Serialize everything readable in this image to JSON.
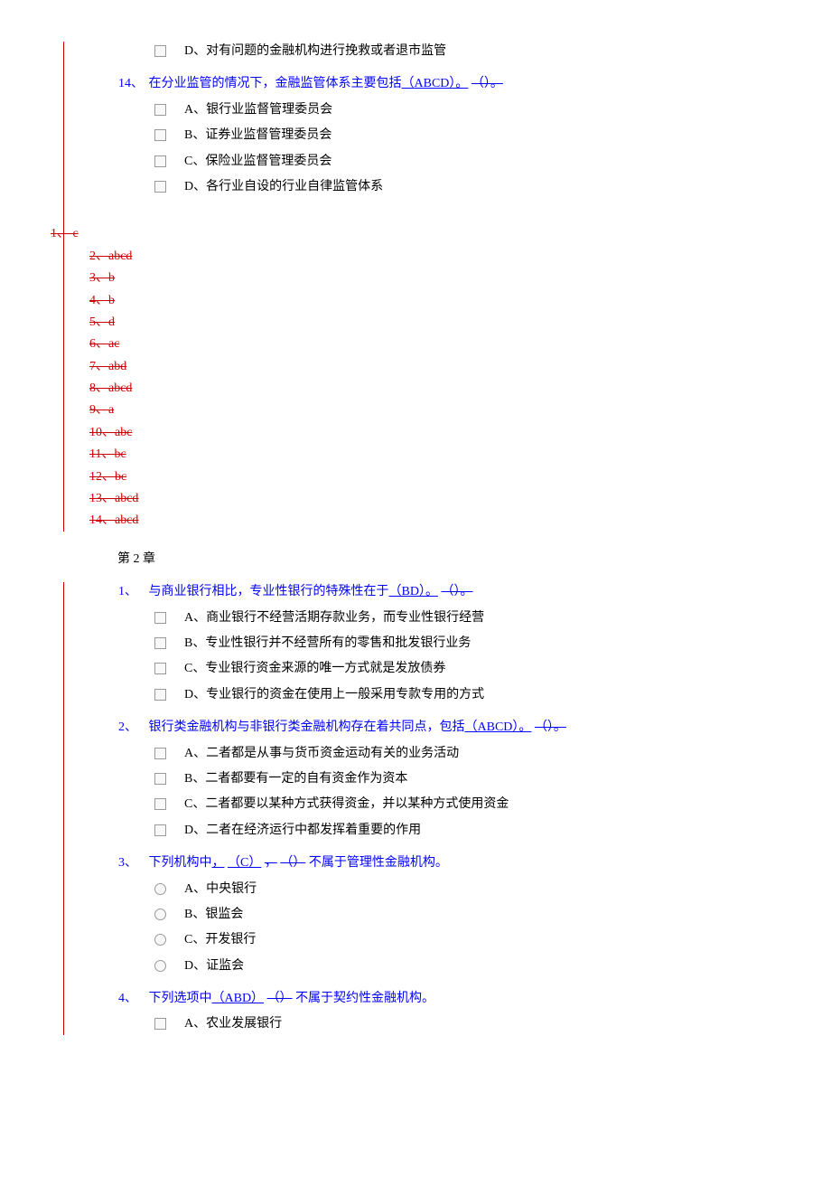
{
  "q13": {
    "optD": "D、对有问题的金融机构进行挽救或者退市监管"
  },
  "q14": {
    "num": "14、",
    "text_pre": "在分业监管的情况下，金融监管体系主要包括",
    "ins": "（ABCD）。",
    "del": "（）。",
    "optA": "A、银行业监督管理委员会",
    "optB": "B、证券业监督管理委员会",
    "optC": "C、保险业监督管理委员会",
    "optD": "D、各行业自设的行业自律监管体系"
  },
  "answers": {
    "a1": "1、    c",
    "a2": "2、abcd",
    "a3": "3、b",
    "a4": "4、b",
    "a5": "5、d",
    "a6": "6、ac",
    "a7": "7、abd",
    "a8": "8、abcd",
    "a9": "9、a",
    "a10": "10、abc",
    "a11": "11、bc",
    "a12": "12、bc",
    "a13": "13、abcd",
    "a14": "14、abcd"
  },
  "chapter2": "第 2 章",
  "c2q1": {
    "num": "1、",
    "text_pre": "与商业银行相比，专业性银行的特殊性在于",
    "ins": "（BD）。",
    "del": "（）。",
    "optA": "A、商业银行不经营活期存款业务，而专业性银行经营",
    "optB": "B、专业性银行并不经营所有的零售和批发银行业务",
    "optC": "C、专业银行资金来源的唯一方式就是发放债券",
    "optD": "D、专业银行的资金在使用上一般采用专款专用的方式"
  },
  "c2q2": {
    "num": "2、",
    "text_pre": "银行类金融机构与非银行类金融机构存在着共同点，包括",
    "ins": "（ABCD）。",
    "del": "（）。",
    "optA": "A、二者都是从事与货币资金运动有关的业务活动",
    "optB": "B、二者都要有一定的自有资金作为资本",
    "optC": "C、二者都要以某种方式获得资金，并以某种方式使用资金",
    "optD": "D、二者在经济运行中都发挥着重要的作用"
  },
  "c2q3": {
    "num": "3、",
    "text_pre": "下列机构中",
    "ins_comma": "，",
    "ins": "（C）",
    "del_comma": "，",
    "del": "（）",
    "text_post": "不属于管理性金融机构。",
    "optA": "A、中央银行",
    "optB": "B、银监会",
    "optC": "C、开发银行",
    "optD": "D、证监会"
  },
  "c2q4": {
    "num": "4、",
    "text_pre": "下列选项中",
    "ins": "（ABD）",
    "del": "（）",
    "text_post": "不属于契约性金融机构。",
    "optA": "A、农业发展银行"
  }
}
